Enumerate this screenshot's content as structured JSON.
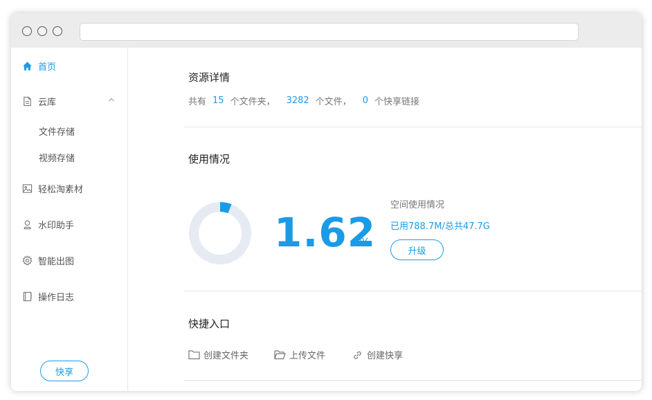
{
  "sidebar": {
    "items": [
      {
        "label": "首页",
        "icon": "home-icon",
        "active": true
      },
      {
        "label": "云库",
        "icon": "document-icon",
        "expanded": true,
        "children": [
          {
            "label": "文件存储"
          },
          {
            "label": "视频存储"
          }
        ]
      },
      {
        "label": "轻松淘素材",
        "icon": "image-icon"
      },
      {
        "label": "水印助手",
        "icon": "user-icon"
      },
      {
        "label": "智能出图",
        "icon": "gear-icon"
      },
      {
        "label": "操作日志",
        "icon": "book-icon"
      }
    ],
    "share_button": "快享"
  },
  "resources": {
    "title": "资源详情",
    "prefix": "共有",
    "folders": "15",
    "folders_unit": "个文件夹，",
    "files": "3282",
    "files_unit": "个文件，",
    "links": "0",
    "links_unit": "个快享链接"
  },
  "usage": {
    "title": "使用情况",
    "percent_value": "1.62",
    "percent_sign": "%",
    "percent_fraction": 0.0162,
    "label": "空间使用情况",
    "detail": "已用788.7M/总共47.7G",
    "upgrade_button": "升级"
  },
  "quick": {
    "title": "快捷入口",
    "actions": [
      {
        "label": "创建文件夹",
        "icon": "folder-icon"
      },
      {
        "label": "上传文件",
        "icon": "open-folder-icon"
      },
      {
        "label": "创建快享",
        "icon": "link-icon"
      }
    ]
  },
  "colors": {
    "accent": "#1a9be6",
    "donut_track": "#e6eaf3"
  }
}
